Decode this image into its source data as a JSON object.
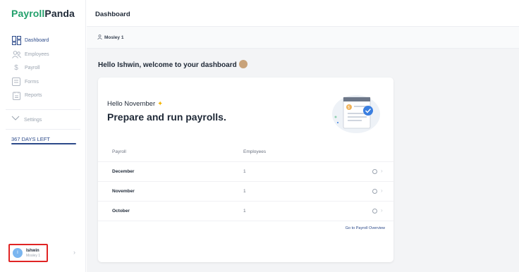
{
  "app": {
    "logo_part1": "Payroll",
    "logo_part2": "Panda"
  },
  "header": {
    "title": "Dashboard"
  },
  "sidebar": {
    "items": [
      {
        "label": "Dashboard",
        "icon": "dashboard-icon",
        "active": true
      },
      {
        "label": "Employees",
        "icon": "employees-icon",
        "active": false
      },
      {
        "label": "Payroll",
        "icon": "dollar-icon",
        "active": false
      },
      {
        "label": "Forms",
        "icon": "forms-icon",
        "active": false
      },
      {
        "label": "Reports",
        "icon": "reports-icon",
        "active": false
      }
    ],
    "settings_label": "Settings",
    "days_left": "367 DAYS LEFT"
  },
  "user": {
    "initial": "I",
    "name": "Ishwin",
    "org": "Mosley 1"
  },
  "org_bar": {
    "label": "Mosley 1"
  },
  "welcome": {
    "text": "Hello Ishwin, welcome to your dashboard"
  },
  "card": {
    "hello": "Hello November",
    "headline": "Prepare and run payrolls.",
    "columns": {
      "payroll": "Payroll",
      "employees": "Employees"
    },
    "rows": [
      {
        "month": "December",
        "employees": "1"
      },
      {
        "month": "November",
        "employees": "1"
      },
      {
        "month": "October",
        "employees": "1"
      }
    ],
    "overview_link": "Go to Payroll Overview"
  },
  "colors": {
    "brand_green": "#22a06b",
    "brand_dark": "#1f2937",
    "nav_active": "#2c4a8a",
    "highlight": "#e02424"
  }
}
